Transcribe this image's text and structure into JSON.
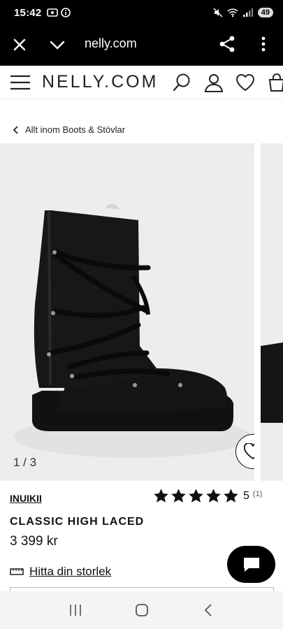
{
  "status_bar": {
    "time": "15:42",
    "battery": "49"
  },
  "browser": {
    "url": "nelly.com"
  },
  "site": {
    "logo": "NELLY.COM"
  },
  "breadcrumb": {
    "label": "Allt inom Boots & Stövlar"
  },
  "gallery": {
    "counter": "1 / 3"
  },
  "product": {
    "brand": "INUIKII",
    "rating_value": "5",
    "rating_count": "(1)",
    "stars": 5,
    "name": "CLASSIC HIGH LACED",
    "price": "3 399 kr",
    "size_guide": "Hitta din storlek"
  },
  "colors": {
    "accent": "#000000",
    "image_bg": "#ededed",
    "nav_bg": "#f4f3f6"
  }
}
